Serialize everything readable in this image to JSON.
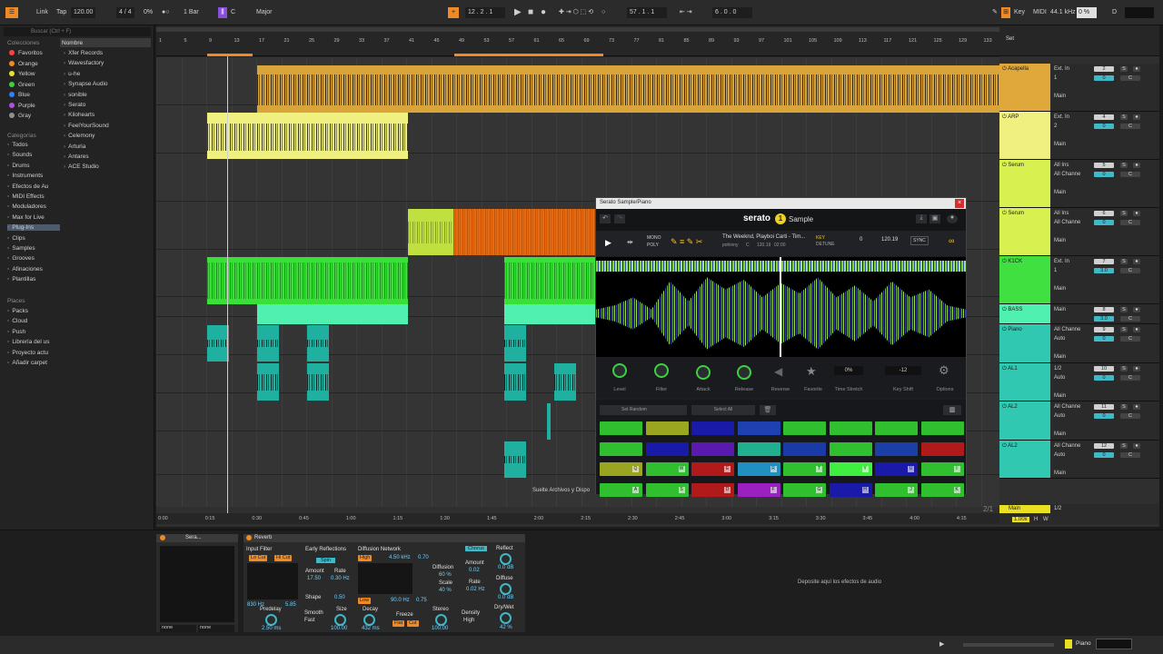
{
  "topbar": {
    "link": "Link",
    "tap": "Tap",
    "tempo": "120.00",
    "sig": "4 / 4",
    "pct": "0%",
    "quant": "1 Bar",
    "key_root": "C",
    "key_scale": "Major",
    "position": "12 .   2 .   1",
    "pos2": "57 .   1 .   1",
    "pos3": "6 .   0 .   0",
    "key_label": "Key",
    "midi": "MIDI",
    "samplerate": "44.1 kHz",
    "cpu": "0 %",
    "d_label": "D"
  },
  "sidebar": {
    "search_placeholder": "Buscar (Ctrl + F)",
    "col_header": "Colecciones",
    "name_header": "Nombre",
    "collections": [
      {
        "label": "Favoritos",
        "color": "#ff4040"
      },
      {
        "label": "Orange",
        "color": "#f08a24"
      },
      {
        "label": "Yellow",
        "color": "#e8e030"
      },
      {
        "label": "Green",
        "color": "#40d040"
      },
      {
        "label": "Blue",
        "color": "#3080ff"
      },
      {
        "label": "Purple",
        "color": "#b050e0"
      },
      {
        "label": "Gray",
        "color": "#909090"
      }
    ],
    "cat_header": "Categorías",
    "categories": [
      "Todos",
      "Sounds",
      "Drums",
      "Instruments",
      "Efectos de Au",
      "MIDI Effects",
      "Moduladores",
      "Max for Live",
      "Plug-Ins",
      "Clips",
      "Samples",
      "Grooves",
      "Afinaciones",
      "Plantillas"
    ],
    "selected_category": "Plug-Ins",
    "places_header": "Places",
    "places": [
      "Packs",
      "Cloud",
      "Push",
      "Librería del us",
      "Proyecto actu",
      "Añadir carpet"
    ],
    "plugins": [
      "Xfer Records",
      "Wavesfactory",
      "u-he",
      "Synapse Audio",
      "sonible",
      "Serato",
      "Kilohearts",
      "FeelYourSound",
      "Celemony",
      "Arturia",
      "Antares",
      "ACE Studio"
    ]
  },
  "ruler": {
    "bars": [
      "1",
      "5",
      "9",
      "13",
      "17",
      "21",
      "25",
      "29",
      "33",
      "37",
      "41",
      "45",
      "49",
      "53",
      "57",
      "61",
      "65",
      "69",
      "73",
      "77",
      "81",
      "85",
      "89",
      "93",
      "97",
      "101",
      "105",
      "109",
      "113",
      "117",
      "121",
      "125",
      "129",
      "133"
    ],
    "set": "Set",
    "times": [
      "0:00",
      "0:15",
      "0:30",
      "0:45",
      "1:00",
      "1:15",
      "1:30",
      "1:45",
      "2:00",
      "2:15",
      "2:30",
      "2:45",
      "3:00",
      "3:15",
      "3:30",
      "3:45",
      "4:00",
      "4:15"
    ],
    "page": "2/1"
  },
  "tracks": [
    {
      "name": "Acapella",
      "color": "#e0a83a",
      "in": "Ext. In",
      "ch": "1",
      "mode": "Main",
      "num": "2",
      "vol": "0"
    },
    {
      "name": "ARP",
      "color": "#f0f080",
      "in": "Ext. In",
      "ch": "2",
      "mode": "Main",
      "num": "4",
      "vol": "0"
    },
    {
      "name": "Serum",
      "color": "#d8f050",
      "in": "All Ins",
      "ch": "All Channe",
      "mode": "Main",
      "num": "5",
      "vol": "0"
    },
    {
      "name": "Serum",
      "color": "#d8f050",
      "in": "All Ins",
      "ch": "All Channe",
      "mode": "Main",
      "num": "6",
      "vol": "0"
    },
    {
      "name": "K1CK",
      "color": "#40e040",
      "in": "Ext. In",
      "ch": "1",
      "mode": "Main",
      "num": "7",
      "vol": "3.0"
    },
    {
      "name": "BASS",
      "color": "#50f0b0",
      "in": "Main",
      "ch": "",
      "mode": "",
      "num": "8",
      "vol": "3.0"
    },
    {
      "name": "Piano",
      "color": "#30c8b0",
      "in": "All Channe",
      "ch": "Auto",
      "mode": "Main",
      "num": "9",
      "vol": "0"
    },
    {
      "name": "AL1",
      "color": "#30c8b0",
      "in": "1/2",
      "ch": "Auto",
      "mode": "Main",
      "num": "10",
      "vol": "0"
    },
    {
      "name": "AL2",
      "color": "#30c8b0",
      "in": "All Channe",
      "ch": "Auto",
      "mode": "Main",
      "num": "11",
      "vol": "0"
    },
    {
      "name": "AL2",
      "color": "#30c8b0",
      "in": "All Channe",
      "ch": "Auto",
      "mode": "Main",
      "num": "12",
      "vol": "0"
    }
  ],
  "main_track": {
    "name": "Main",
    "in": "1/2",
    "zoom": "1.00x",
    "h": "H",
    "w": "W"
  },
  "drop_hint": "Suelte Archivos y Dispo",
  "serato": {
    "window_title": "Serato Sample/Piano",
    "logo": "serato",
    "logo_badge": "1",
    "product": "Sample",
    "mono": "MONO",
    "poly": "POLY",
    "song": "The Weeknd, Playboi Carti - Tim...",
    "artist": "pohinny",
    "song_key": "C",
    "song_bpm": "120.19",
    "song_len": "02:00",
    "key_label": "KEY",
    "detune_label": "DETUNE",
    "key_val": "0",
    "bpm": "120.19",
    "sync": "SYNC",
    "knobs": [
      "Level",
      "Filter",
      "Attack",
      "Release",
      "Reverse",
      "Favorite",
      "Time Stretch",
      "Key Shift",
      "Options"
    ],
    "time_stretch": "0%",
    "key_shift": "-12",
    "set_random": "Set Random",
    "select_all": "Select All",
    "pads": [
      {
        "c": "#2fbf2f",
        "n": ""
      },
      {
        "c": "#9aa520",
        "n": ""
      },
      {
        "c": "#1a1aa8",
        "n": ""
      },
      {
        "c": "#1e40b0",
        "n": ""
      },
      {
        "c": "#2fbf2f",
        "n": ""
      },
      {
        "c": "#2fbf2f",
        "n": ""
      },
      {
        "c": "#2fbf2f",
        "n": ""
      },
      {
        "c": "#2fbf2f",
        "n": ""
      },
      {
        "c": "#2fbf2f",
        "n": ""
      },
      {
        "c": "#1a1aa8",
        "n": ""
      },
      {
        "c": "#5a1ab0",
        "n": ""
      },
      {
        "c": "#20b090",
        "n": ""
      },
      {
        "c": "#1a3aa8",
        "n": ""
      },
      {
        "c": "#2fbf2f",
        "n": ""
      },
      {
        "c": "#1a40a8",
        "n": ""
      },
      {
        "c": "#b01a1a",
        "n": ""
      },
      {
        "c": "#9aa520",
        "n": "Q"
      },
      {
        "c": "#2fbf2f",
        "n": "W"
      },
      {
        "c": "#b01a1a",
        "n": "E"
      },
      {
        "c": "#2090c0",
        "n": "R"
      },
      {
        "c": "#2fbf2f",
        "n": "T"
      },
      {
        "c": "#40f040",
        "n": "Y"
      },
      {
        "c": "#1a1aa8",
        "n": "U"
      },
      {
        "c": "#2fbf2f",
        "n": "I"
      },
      {
        "c": "#2fbf2f",
        "n": "A"
      },
      {
        "c": "#2fbf2f",
        "n": "S"
      },
      {
        "c": "#b01a1a",
        "n": "D"
      },
      {
        "c": "#9a20c0",
        "n": "F"
      },
      {
        "c": "#2fbf2f",
        "n": "G"
      },
      {
        "c": "#1a1aa8",
        "n": "H"
      },
      {
        "c": "#2fbf2f",
        "n": "J"
      },
      {
        "c": "#2fbf2f",
        "n": "K"
      }
    ]
  },
  "device_chain": {
    "inst_title": "Sera...",
    "reverb_title": "Reverb",
    "none1": "none",
    "none2": "none",
    "input_filter": "Input Filter",
    "lo_cut": "Lo Cut",
    "hi_cut": "Hi Cut",
    "freq_lo": "830 Hz",
    "q_val": "5.85",
    "early_ref": "Early Reflections",
    "spin": "Spin",
    "amount_lbl": "Amount",
    "rate_lbl": "Rate",
    "amount_val": "17.50",
    "rate_val": "0.30 Hz",
    "shape_lbl": "Shape",
    "shape_val": "0.50",
    "diffusion": "Diffusion Network",
    "high": "High",
    "shelf": "4.50 kHz",
    "shelf_q": "0.70",
    "low": "Low",
    "low_f": "90.0 Hz",
    "low_q": "0.75",
    "diff_lbl": "Diffusion",
    "diff_val": "60 %",
    "scale_lbl": "Scale",
    "scale_val": "40 %",
    "chorus": "Chorus",
    "ch_amount": "Amount",
    "ch_amount_val": "0.02",
    "ch_rate": "Rate",
    "ch_rate_val": "0.02 Hz",
    "reflect": "Reflect",
    "reflect_val": "0.0 dB",
    "diffuse": "Diffuse",
    "diffuse_val": "0.0 dB",
    "drywet": "Dry/Wet",
    "drywet_val": "42 %",
    "predelay": "Predelay",
    "predelay_val": "2.50 ms",
    "smooth": "Smooth",
    "smooth_val": "Fast",
    "size": "Size",
    "size_val": "100.00",
    "decay": "Decay",
    "decay_val": "432 ms",
    "freeze": "Freeze",
    "flat": "Flat",
    "cut": "Cut",
    "stereo": "Stereo",
    "stereo_val": "100.00",
    "density": "Density",
    "density_val": "High",
    "drop_effects": "Deposite aquí los efectos de audio"
  },
  "status": {
    "track": "Piano"
  }
}
